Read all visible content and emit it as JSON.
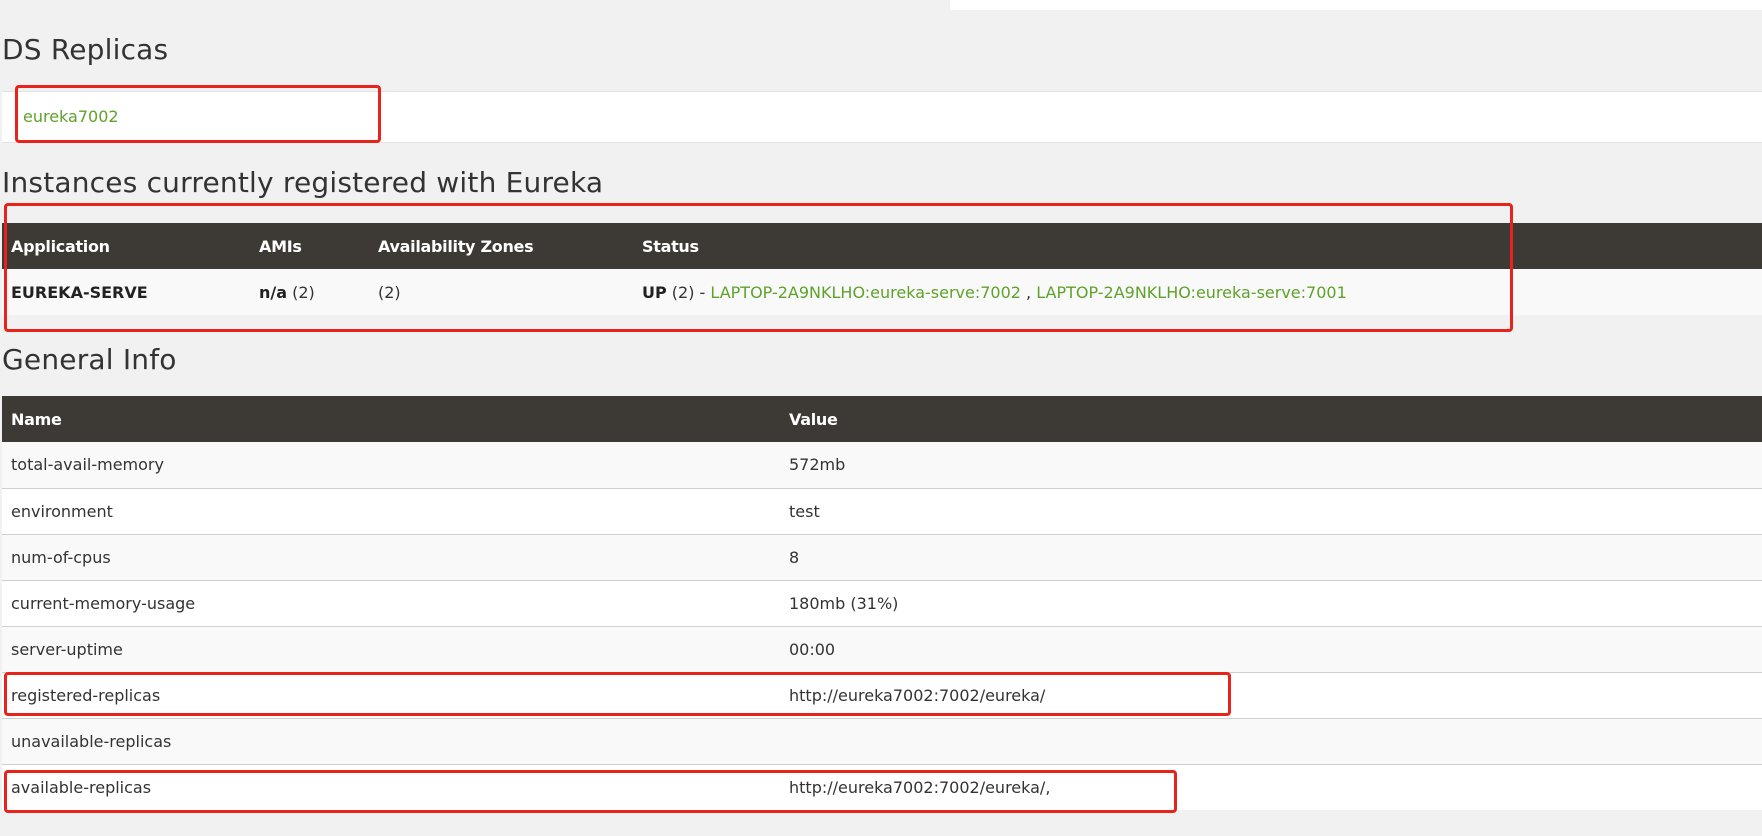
{
  "sections": {
    "ds_replicas_title": "DS Replicas",
    "instances_title": "Instances currently registered with Eureka",
    "general_info_title": "General Info"
  },
  "replicas": [
    {
      "label": "eureka7002"
    }
  ],
  "instances": {
    "headers": [
      "Application",
      "AMIs",
      "Availability Zones",
      "Status"
    ],
    "rows": [
      {
        "application": "EUREKA-SERVE",
        "ami_key": "n/a",
        "ami_count": " (2)",
        "zones": "(2)",
        "status_state": "UP",
        "status_count": " (2) - ",
        "instance_1": "LAPTOP-2A9NKLHO:eureka-serve:7002",
        "separator": " , ",
        "instance_2": "LAPTOP-2A9NKLHO:eureka-serve:7001"
      }
    ]
  },
  "general_info": {
    "headers": [
      "Name",
      "Value"
    ],
    "rows": [
      {
        "name": "total-avail-memory",
        "value": "572mb"
      },
      {
        "name": "environment",
        "value": "test"
      },
      {
        "name": "num-of-cpus",
        "value": "8"
      },
      {
        "name": "current-memory-usage",
        "value": "180mb (31%)"
      },
      {
        "name": "server-uptime",
        "value": "00:00"
      },
      {
        "name": "registered-replicas",
        "value": "http://eureka7002:7002/eureka/"
      },
      {
        "name": "unavailable-replicas",
        "value": ""
      },
      {
        "name": "available-replicas",
        "value": "http://eureka7002:7002/eureka/,"
      }
    ]
  },
  "colors": {
    "link_green": "#5fa22a",
    "header_dark": "#3d3935",
    "annotation_red": "#e8231b"
  }
}
